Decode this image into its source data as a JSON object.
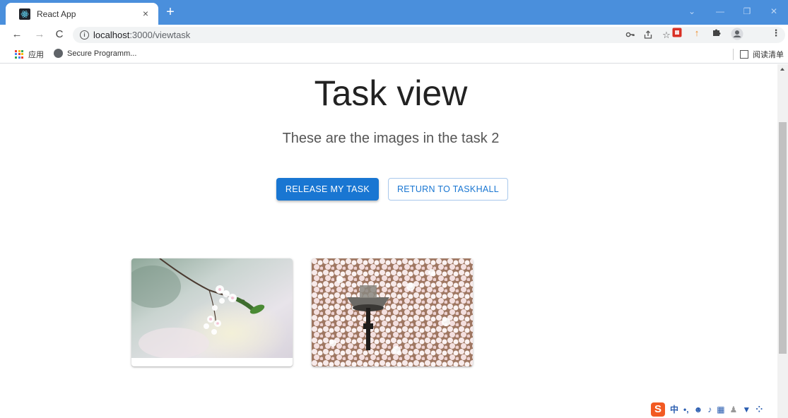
{
  "browser": {
    "tab": {
      "title": "React App",
      "close_glyph": "×"
    },
    "new_tab_glyph": "+",
    "nav": {
      "back_glyph": "←",
      "forward_glyph": "→",
      "reload_glyph": "C"
    },
    "address": {
      "host": "localhost",
      "path": ":3000/viewtask"
    },
    "bookmarks": [
      {
        "label": "应用",
        "icon": "apps-grid-icon"
      },
      {
        "label": "Secure Programm...",
        "icon": "globe-icon"
      }
    ],
    "reading_list": "阅读清单",
    "toolbar_icons": [
      "key-icon",
      "share-icon",
      "star-icon",
      "extension-red-icon",
      "arrow-up-icon",
      "puzzle-icon",
      "profile-icon",
      "kebab-menu-icon"
    ],
    "window_controls": [
      "chevron-down-icon",
      "minimize-icon",
      "restore-icon",
      "close-icon"
    ]
  },
  "page": {
    "title": "Task view",
    "subtitle": "These are the images in the task 2",
    "buttons": {
      "release": "RELEASE MY TASK",
      "return": "RETURN TO TASKHALL"
    },
    "images": [
      {
        "subject": "cherry blossom branch"
      },
      {
        "subject": "cherry blossoms with street lamp"
      }
    ]
  },
  "ime": {
    "mode": "中"
  },
  "colors": {
    "tabstrip": "#4a8fdc",
    "primary": "#1976d2",
    "ime_brand": "#f25a22"
  }
}
